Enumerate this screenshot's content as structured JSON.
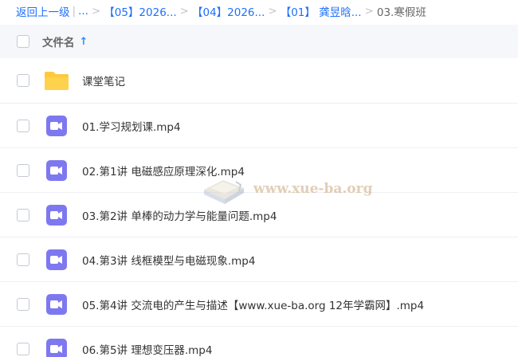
{
  "breadcrumb": {
    "back": "返回上一级",
    "pipe": "|",
    "ellipsis": "...",
    "sep": ">",
    "items": [
      "【05】2026...",
      "【04】2026...",
      "【01】 龚昱晗..."
    ],
    "current": "03.寒假班"
  },
  "header": {
    "filename_label": "文件名",
    "sort_arrow": "↑"
  },
  "files": [
    {
      "name": "课堂笔记",
      "type": "folder"
    },
    {
      "name": "01.学习规划课.mp4",
      "type": "video"
    },
    {
      "name": "02.第1讲 电磁感应原理深化.mp4",
      "type": "video"
    },
    {
      "name": "03.第2讲 单棒的动力学与能量问题.mp4",
      "type": "video"
    },
    {
      "name": "04.第3讲 线框模型与电磁现象.mp4",
      "type": "video"
    },
    {
      "name": "05.第4讲 交流电的产生与描述【www.xue-ba.org 12年学霸网】.mp4",
      "type": "video"
    },
    {
      "name": "06.第5讲 理想变压器.mp4",
      "type": "video"
    }
  ],
  "watermark": {
    "text": "www.xue-ba.org"
  },
  "colors": {
    "link": "#1e6fff",
    "folder": "#ffc93c",
    "video": "#7e78f0",
    "header_bg": "#f5f7fa"
  }
}
